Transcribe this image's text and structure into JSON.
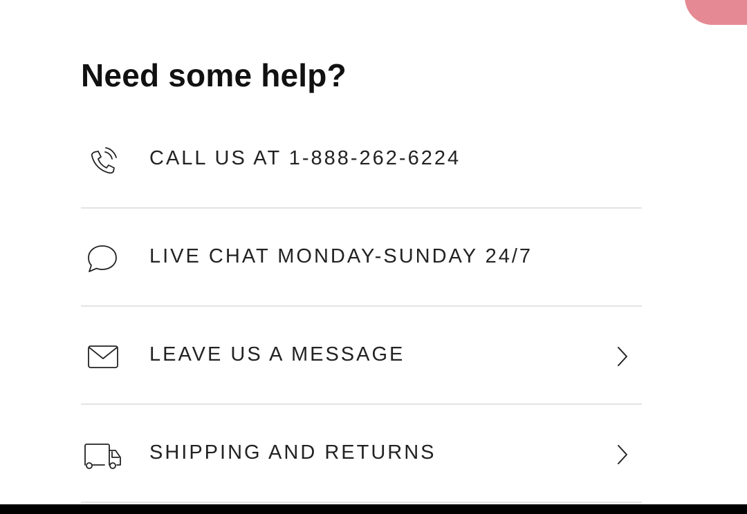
{
  "help": {
    "title": "Need some help?",
    "items": [
      {
        "label": "CALL US AT 1-888-262-6224",
        "icon": "phone-icon",
        "has_chevron": false
      },
      {
        "label": "LIVE CHAT MONDAY-SUNDAY 24/7",
        "icon": "chat-bubble-icon",
        "has_chevron": false
      },
      {
        "label": "LEAVE US A MESSAGE",
        "icon": "envelope-icon",
        "has_chevron": true
      },
      {
        "label": "SHIPPING AND RETURNS",
        "icon": "truck-icon",
        "has_chevron": true
      }
    ]
  },
  "colors": {
    "accent": "#e58a94",
    "text": "#222222",
    "divider": "#e3e3e3"
  }
}
